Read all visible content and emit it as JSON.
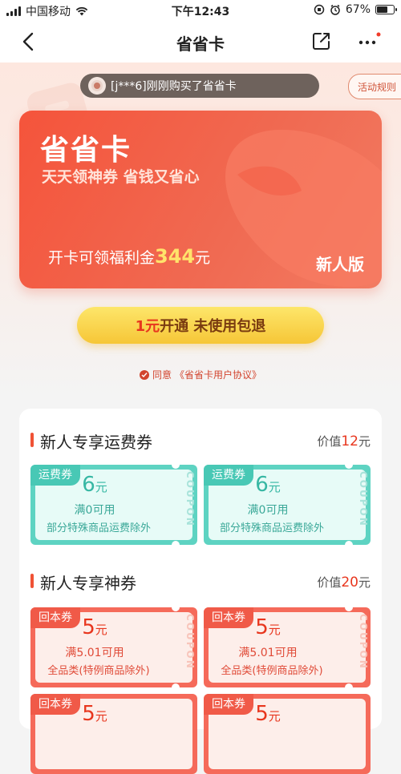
{
  "status_bar": {
    "carrier": "中国移动",
    "time": "下午12:43",
    "battery": "67%",
    "battery_level": 0.67
  },
  "nav": {
    "title": "省省卡",
    "icons": [
      "back-arrow-icon",
      "share-icon",
      "more-icon"
    ]
  },
  "ticker": {
    "text": "[j***6]刚刚购买了省省卡"
  },
  "rules_label": "活动规则",
  "card": {
    "title": "省省卡",
    "subtitle": "天天领神券 省钱又省心",
    "benefit_prefix": "开卡可领福利金",
    "benefit_amount": "344",
    "benefit_unit": "元",
    "edition": "新人版"
  },
  "cta": {
    "price": "1元",
    "label": "开通 未使用包退"
  },
  "agreement": {
    "prefix": "同意",
    "link": "《省省卡用户协议》"
  },
  "sections": [
    {
      "title": "新人专享运费券",
      "value_prefix": "价值",
      "value_num": "12",
      "value_unit": "元",
      "coupons": [
        {
          "tag": "运费券",
          "amount": "6",
          "unit": "元",
          "condition": "满0可用",
          "note": "部分特殊商品运费除外",
          "side": "COUPON"
        },
        {
          "tag": "运费券",
          "amount": "6",
          "unit": "元",
          "condition": "满0可用",
          "note": "部分特殊商品运费除外",
          "side": "COUPON"
        }
      ]
    },
    {
      "title": "新人专享神券",
      "value_prefix": "价值",
      "value_num": "20",
      "value_unit": "元",
      "coupons": [
        {
          "tag": "回本券",
          "amount": "5",
          "unit": "元",
          "condition": "满5.01可用",
          "note": "全品类(特例商品除外)",
          "side": "COUPON"
        },
        {
          "tag": "回本券",
          "amount": "5",
          "unit": "元",
          "condition": "满5.01可用",
          "note": "全品类(特例商品除外)",
          "side": "COUPON"
        },
        {
          "tag": "回本券",
          "amount": "5",
          "unit": "元",
          "condition": "",
          "note": "",
          "side": ""
        },
        {
          "tag": "回本券",
          "amount": "5",
          "unit": "元",
          "condition": "",
          "note": "",
          "side": ""
        }
      ]
    }
  ],
  "colors": {
    "brand_red": "#f5543b",
    "cta_yellow": "#f6c637",
    "teal_coupon": "#5ed3c2",
    "red_coupon": "#f56a5a",
    "price_red": "#e8361e"
  }
}
